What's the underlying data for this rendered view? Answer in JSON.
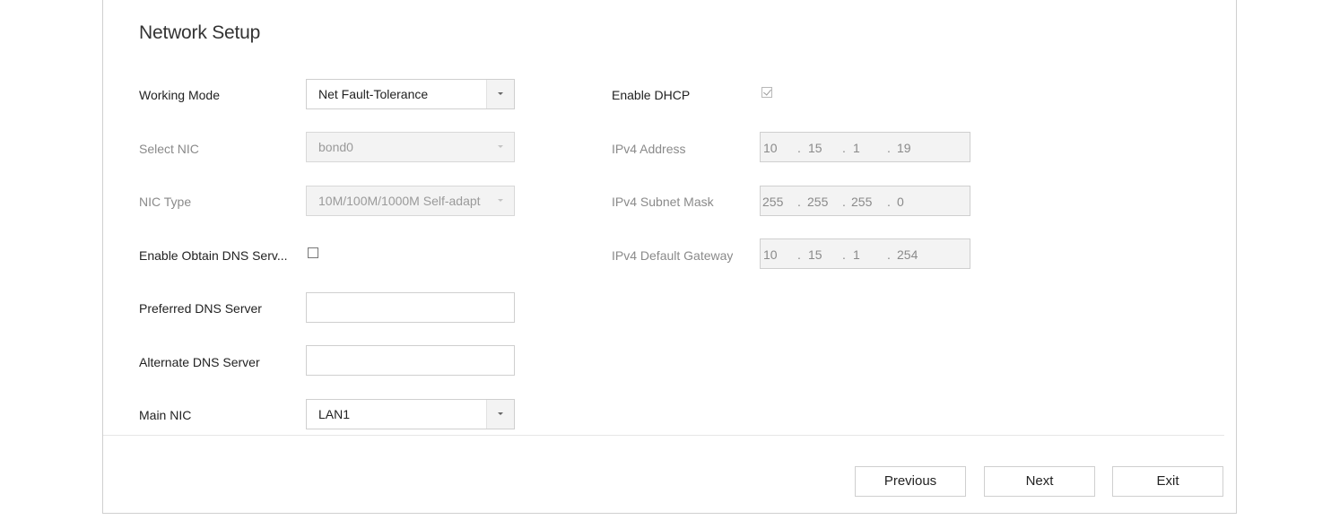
{
  "title": "Network Setup",
  "left": {
    "working_mode": {
      "label": "Working Mode",
      "value": "Net Fault-Tolerance"
    },
    "select_nic": {
      "label": "Select NIC",
      "value": "bond0"
    },
    "nic_type": {
      "label": "NIC Type",
      "value": "10M/100M/1000M Self-adapt"
    },
    "enable_obtain_dns": {
      "label": "Enable Obtain DNS Serv...",
      "checked": false
    },
    "preferred_dns": {
      "label": "Preferred DNS Server",
      "value": ""
    },
    "alternate_dns": {
      "label": "Alternate DNS Server",
      "value": ""
    },
    "main_nic": {
      "label": "Main NIC",
      "value": "LAN1"
    }
  },
  "right": {
    "enable_dhcp": {
      "label": "Enable DHCP",
      "checked": true
    },
    "ipv4_address": {
      "label": "IPv4 Address",
      "octets": [
        "10",
        "15",
        "1",
        "19"
      ]
    },
    "ipv4_subnet_mask": {
      "label": "IPv4 Subnet Mask",
      "octets": [
        "255",
        "255",
        "255",
        "0"
      ]
    },
    "ipv4_default_gateway": {
      "label": "IPv4 Default Gateway",
      "octets": [
        "10",
        "15",
        "1",
        "254"
      ]
    }
  },
  "buttons": {
    "previous": "Previous",
    "next": "Next",
    "exit": "Exit"
  },
  "ip_separator": "."
}
